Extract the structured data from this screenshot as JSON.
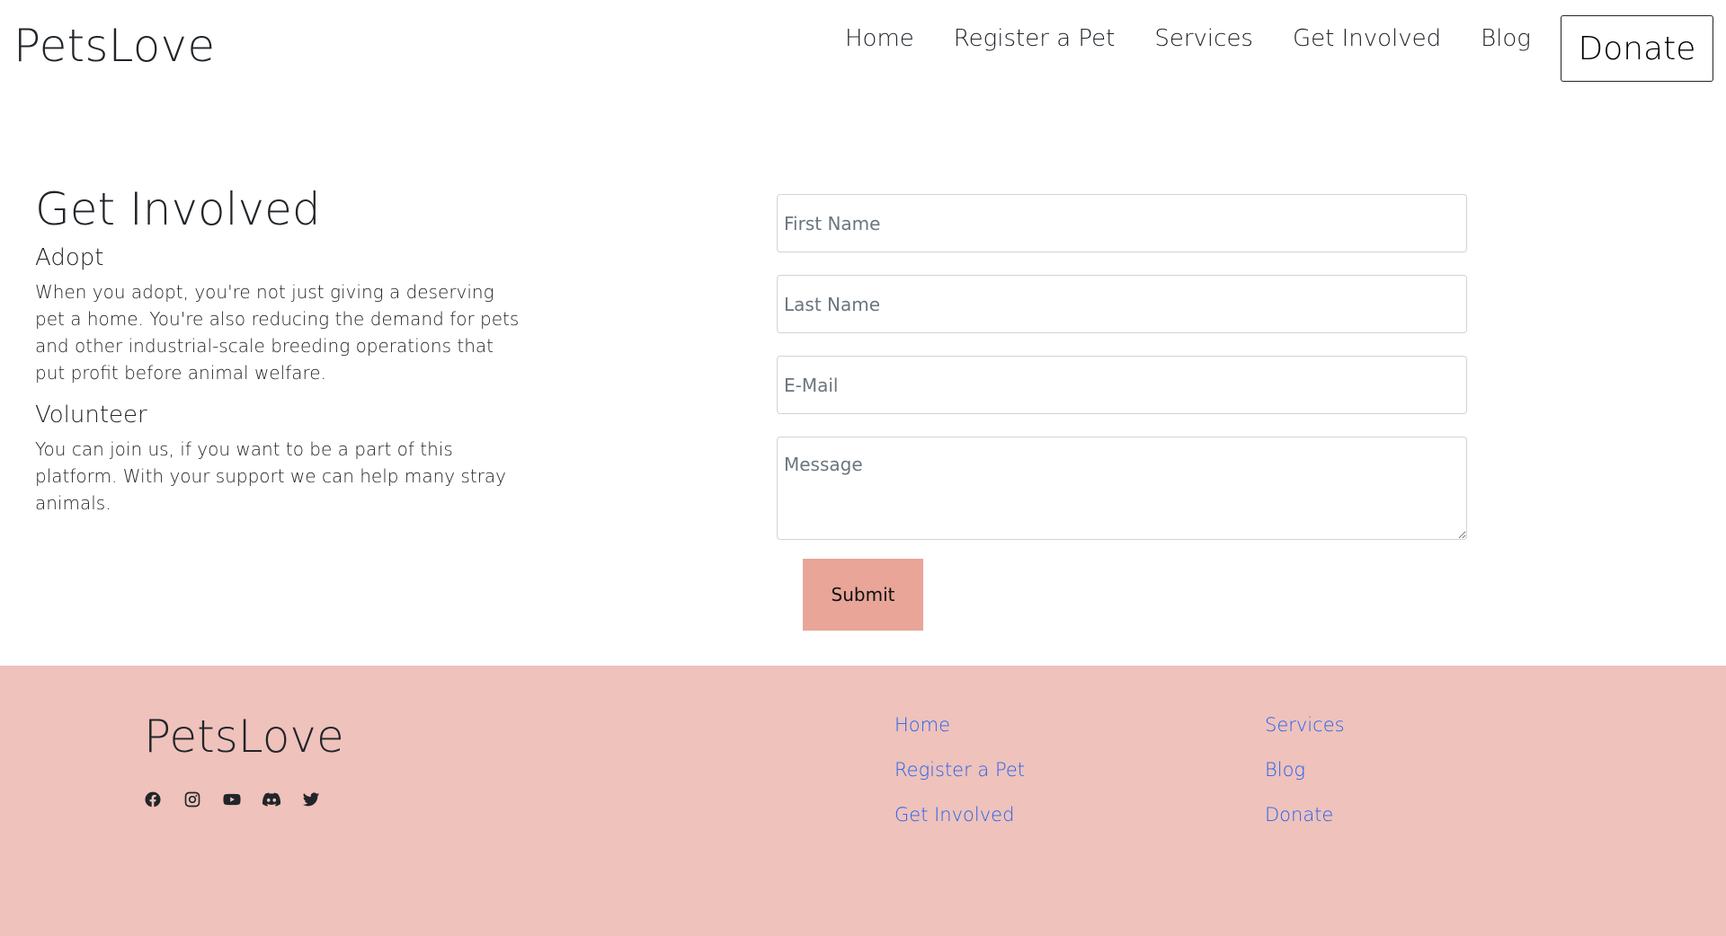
{
  "header": {
    "brand": "PetsLove",
    "nav": [
      "Home",
      "Register a Pet",
      "Services",
      "Get Involved",
      "Blog"
    ],
    "donate_label": "Donate"
  },
  "info": {
    "title": "Get Involved",
    "adopt_heading": "Adopt",
    "adopt_text": "When you adopt, you're not just giving a deserving pet a home. You're also reducing the demand for pets and other industrial-scale breeding operations that put profit before animal welfare.",
    "volunteer_heading": "Volunteer",
    "volunteer_text": "You can join us, if you want to be a part of this platform. With your support we can help many stray animals."
  },
  "form": {
    "first_name_placeholder": "First Name",
    "last_name_placeholder": "Last Name",
    "email_placeholder": "E-Mail",
    "message_placeholder": "Message",
    "submit_label": "Submit"
  },
  "footer": {
    "brand": "PetsLove",
    "socials": [
      "facebook-icon",
      "instagram-icon",
      "youtube-icon",
      "discord-icon",
      "twitter-icon"
    ],
    "links_col1": [
      "Home",
      "Register a Pet",
      "Get Involved"
    ],
    "links_col2": [
      "Services",
      "Blog",
      "Donate"
    ]
  },
  "colors": {
    "footer_bg": "#efc2bc",
    "submit_bg": "#e8a598",
    "link": "#2563eb"
  }
}
